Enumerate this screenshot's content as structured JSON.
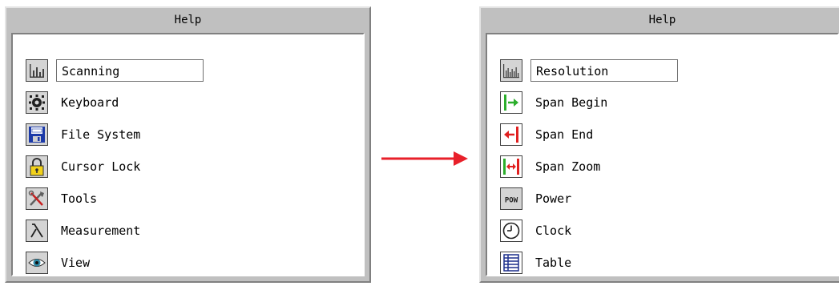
{
  "colors": {
    "panel": "#c0c0c0",
    "arrow": "#e8202a"
  },
  "left_panel": {
    "title": "Help",
    "items": [
      {
        "label": "Scanning",
        "icon": "bar-chart-icon",
        "selected": true
      },
      {
        "label": "Keyboard",
        "icon": "keyboard-icon",
        "selected": false
      },
      {
        "label": "File System",
        "icon": "floppy-disk-icon",
        "selected": false
      },
      {
        "label": "Cursor Lock",
        "icon": "padlock-icon",
        "selected": false
      },
      {
        "label": "Tools",
        "icon": "tools-icon",
        "selected": false
      },
      {
        "label": "Measurement",
        "icon": "lambda-icon",
        "selected": false
      },
      {
        "label": "View",
        "icon": "eye-icon",
        "selected": false
      }
    ]
  },
  "right_panel": {
    "title": "Help",
    "items": [
      {
        "label": "Resolution",
        "icon": "resolution-bars-icon",
        "selected": true
      },
      {
        "label": "Span Begin",
        "icon": "span-begin-icon",
        "selected": false
      },
      {
        "label": "Span End",
        "icon": "span-end-icon",
        "selected": false
      },
      {
        "label": "Span Zoom",
        "icon": "span-zoom-icon",
        "selected": false
      },
      {
        "label": "Power",
        "icon": "pow-icon",
        "icon_text": "POW",
        "selected": false
      },
      {
        "label": "Clock",
        "icon": "clock-icon",
        "selected": false
      },
      {
        "label": "Table",
        "icon": "table-icon",
        "selected": false
      }
    ]
  }
}
